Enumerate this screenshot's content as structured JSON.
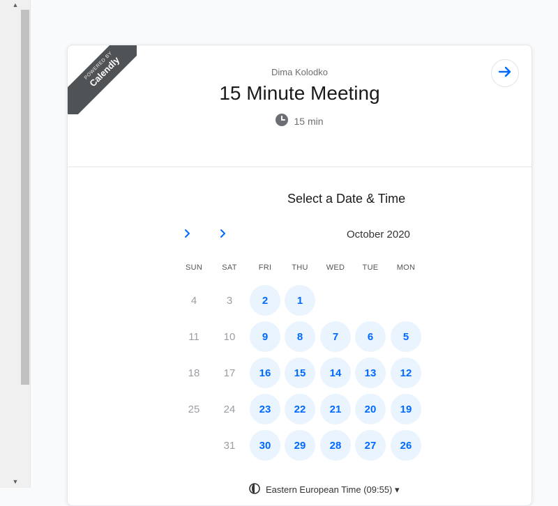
{
  "scrollbar": {
    "up_arrow": "▲",
    "down_arrow": "▼"
  },
  "ribbon": {
    "powered": "POWERED BY",
    "brand": "Calendly"
  },
  "event": {
    "host": "Dima Kolodko",
    "title": "15 Minute Meeting",
    "duration": "15 min"
  },
  "calendar": {
    "heading": "Select a Date & Time",
    "month_label": "October 2020",
    "weekdays": [
      "MON",
      "TUE",
      "WED",
      "THU",
      "FRI",
      "SAT",
      "SUN"
    ],
    "weeks": [
      [
        null,
        null,
        null,
        {
          "d": "1",
          "a": true
        },
        {
          "d": "2",
          "a": true
        },
        {
          "d": "3",
          "a": false
        },
        {
          "d": "4",
          "a": false
        }
      ],
      [
        {
          "d": "5",
          "a": true
        },
        {
          "d": "6",
          "a": true
        },
        {
          "d": "7",
          "a": true
        },
        {
          "d": "8",
          "a": true
        },
        {
          "d": "9",
          "a": true
        },
        {
          "d": "10",
          "a": false
        },
        {
          "d": "11",
          "a": false
        }
      ],
      [
        {
          "d": "12",
          "a": true
        },
        {
          "d": "13",
          "a": true
        },
        {
          "d": "14",
          "a": true
        },
        {
          "d": "15",
          "a": true
        },
        {
          "d": "16",
          "a": true
        },
        {
          "d": "17",
          "a": false
        },
        {
          "d": "18",
          "a": false
        }
      ],
      [
        {
          "d": "19",
          "a": true
        },
        {
          "d": "20",
          "a": true
        },
        {
          "d": "21",
          "a": true
        },
        {
          "d": "22",
          "a": true
        },
        {
          "d": "23",
          "a": true
        },
        {
          "d": "24",
          "a": false
        },
        {
          "d": "25",
          "a": false
        }
      ],
      [
        {
          "d": "26",
          "a": true
        },
        {
          "d": "27",
          "a": true
        },
        {
          "d": "28",
          "a": true
        },
        {
          "d": "29",
          "a": true
        },
        {
          "d": "30",
          "a": true
        },
        {
          "d": "31",
          "a": false
        },
        null
      ]
    ]
  },
  "timezone": {
    "label": "Eastern European Time (09:55) ▾"
  },
  "colors": {
    "accent": "#0069ff",
    "available_bg": "#eaf4fe",
    "ribbon": "#505356"
  }
}
